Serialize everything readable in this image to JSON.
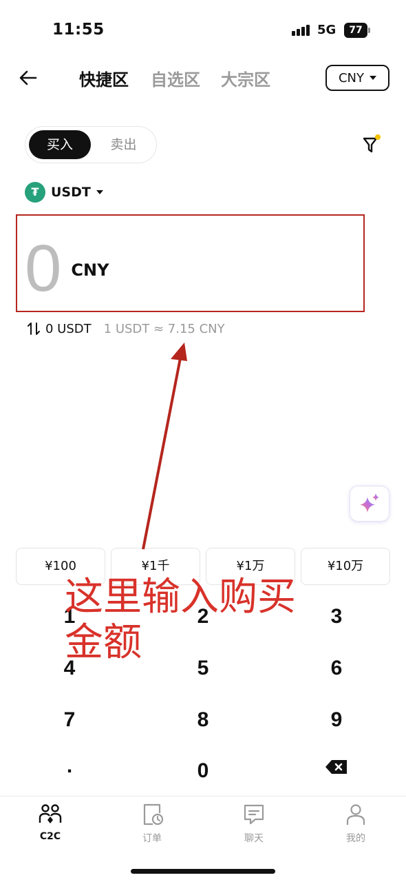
{
  "status_bar": {
    "time": "11:55",
    "network": "5G",
    "battery": "77"
  },
  "header": {
    "tabs": [
      {
        "label": "快捷区",
        "active": true
      },
      {
        "label": "自选区",
        "active": false
      },
      {
        "label": "大宗区",
        "active": false
      }
    ],
    "currency": "CNY"
  },
  "trade_toggle": {
    "buy_label": "买入",
    "sell_label": "卖出",
    "selected": "buy"
  },
  "crypto": {
    "symbol": "USDT",
    "logo_glyph": "₮",
    "logo_color": "#26a17b"
  },
  "amount": {
    "value": "0",
    "unit": "CNY"
  },
  "conversion": {
    "amount": "0 USDT",
    "rate": "1 USDT ≈ 7.15 CNY"
  },
  "quick_amounts": [
    "¥100",
    "¥1千",
    "¥1万",
    "¥10万"
  ],
  "keypad": [
    "1",
    "2",
    "3",
    "4",
    "5",
    "6",
    "7",
    "8",
    "9",
    ".",
    "0",
    "backspace"
  ],
  "annotation": {
    "text": "这里输入购买金额",
    "color": "#d8322a"
  },
  "bottom_nav": [
    {
      "label": "C2C",
      "icon": "users-icon",
      "active": true
    },
    {
      "label": "订单",
      "icon": "orders-icon",
      "active": false
    },
    {
      "label": "聊天",
      "icon": "chat-icon",
      "active": false
    },
    {
      "label": "我的",
      "icon": "profile-icon",
      "active": false
    }
  ]
}
